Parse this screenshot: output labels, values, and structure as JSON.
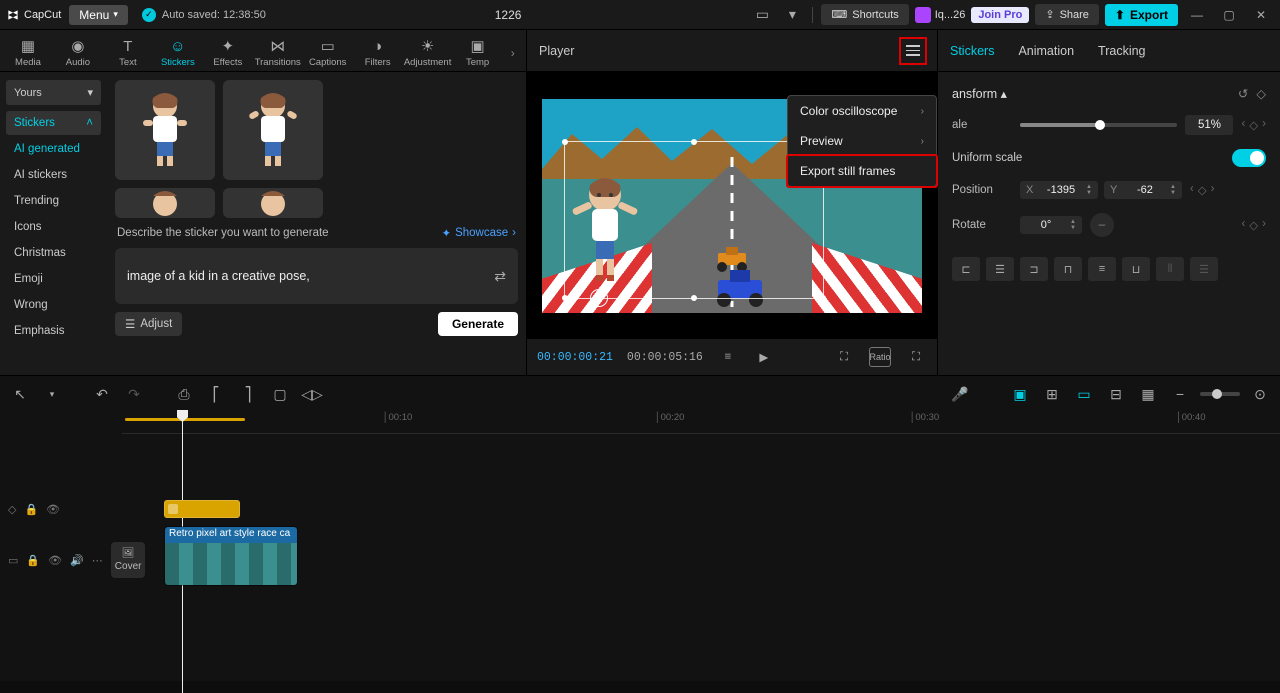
{
  "titlebar": {
    "app": "CapCut",
    "menu": "Menu",
    "autosave": "Auto saved: 12:38:50",
    "doc": "1226",
    "shortcuts": "Shortcuts",
    "account": "Iq...26",
    "joinpro": "Join Pro",
    "share": "Share",
    "export": "Export"
  },
  "tools": {
    "items": [
      {
        "label": "Media"
      },
      {
        "label": "Audio"
      },
      {
        "label": "Text"
      },
      {
        "label": "Stickers"
      },
      {
        "label": "Effects"
      },
      {
        "label": "Transitions"
      },
      {
        "label": "Captions"
      },
      {
        "label": "Filters"
      },
      {
        "label": "Adjustment"
      },
      {
        "label": "Temp"
      }
    ]
  },
  "categories": {
    "dropdown": "Yours",
    "items": [
      {
        "label": "Stickers",
        "expanded": true
      },
      {
        "label": "AI generated",
        "active": true
      },
      {
        "label": "AI stickers"
      },
      {
        "label": "Trending"
      },
      {
        "label": "Icons"
      },
      {
        "label": "Christmas"
      },
      {
        "label": "Emoji"
      },
      {
        "label": "Wrong"
      },
      {
        "label": "Emphasis"
      }
    ]
  },
  "gen": {
    "describe": "Describe the sticker you want to generate",
    "showcase": "Showcase",
    "prompt": "image of a kid in a creative pose,",
    "adjust": "Adjust",
    "generate": "Generate"
  },
  "player": {
    "title": "Player",
    "menu": {
      "osc": "Color oscilloscope",
      "preview": "Preview",
      "export_frames": "Export still frames"
    },
    "time_current": "00:00:00:21",
    "time_total": "00:00:05:16",
    "ratio": "Ratio"
  },
  "inspector": {
    "tabs": {
      "stickers": "Stickers",
      "animation": "Animation",
      "tracking": "Tracking"
    },
    "section": "ansform",
    "scale_label": "ale",
    "scale": "51%",
    "uniform": "Uniform scale",
    "position": "Position",
    "x_label": "X",
    "x": "-1395",
    "y_label": "Y",
    "y": "-62",
    "rotate": "Rotate",
    "rotate_val": "0°"
  },
  "timeline": {
    "ticks": [
      "00:10",
      "00:20",
      "00:30",
      "00:40"
    ],
    "cover": "Cover",
    "video_clip": "Retro pixel art style race ca"
  }
}
